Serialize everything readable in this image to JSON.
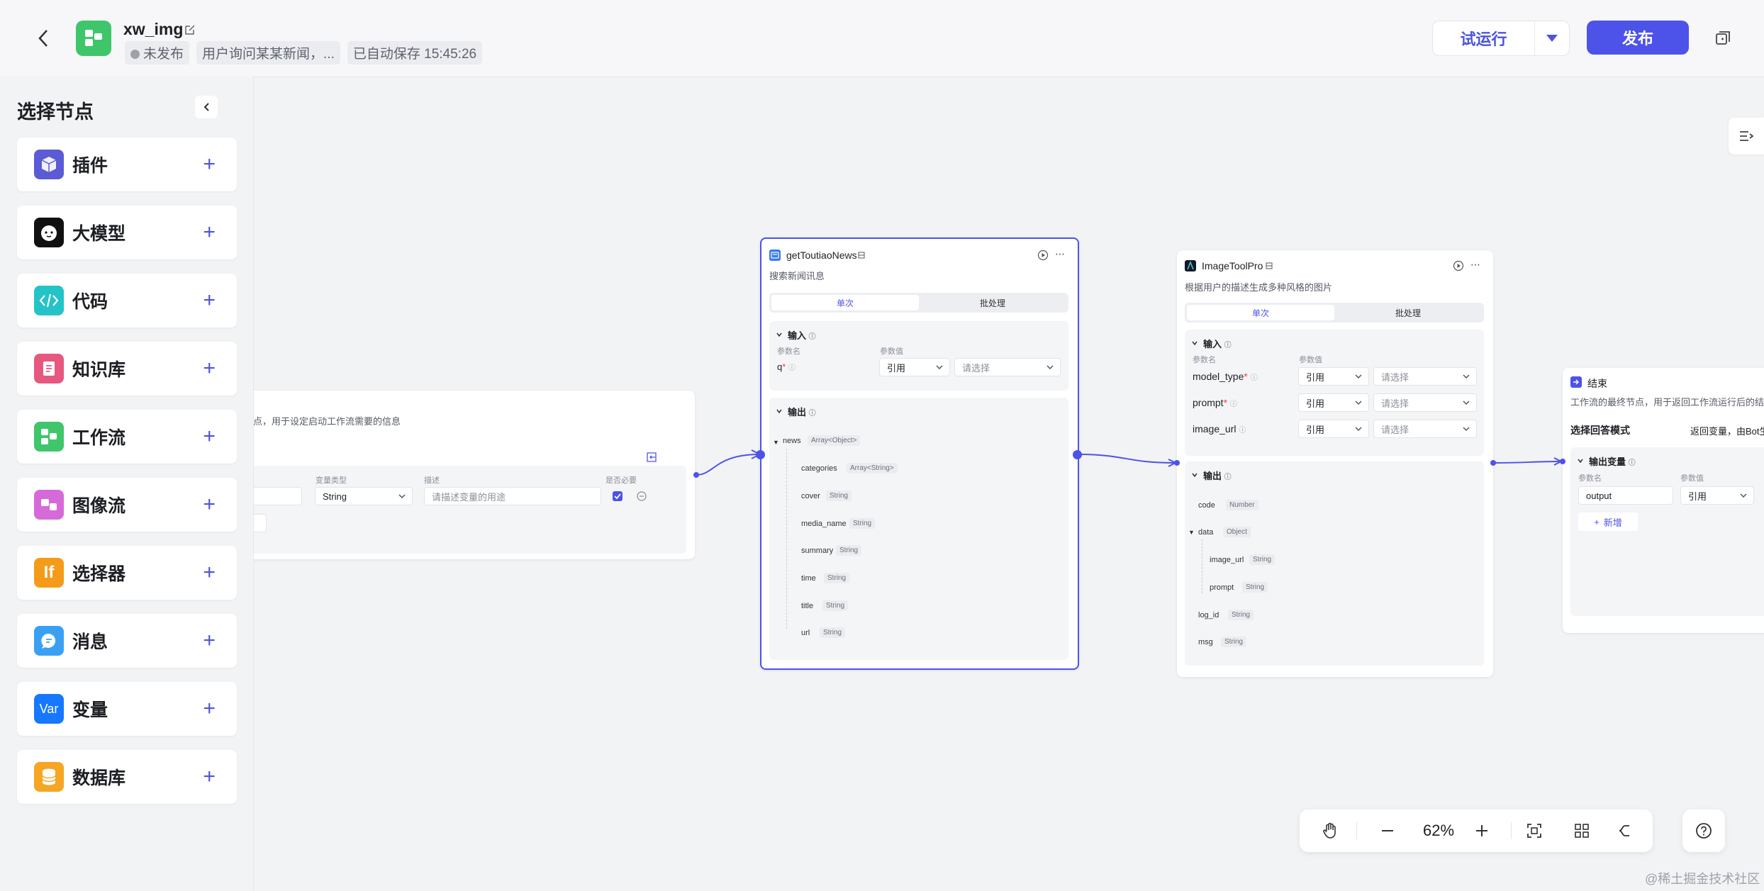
{
  "header": {
    "app_name": "xw_img",
    "status": "未发布",
    "description": "用户询问某某新闻，...",
    "autosave": "已自动保存 15:45:26",
    "trial_run_label": "试运行",
    "publish_label": "发布"
  },
  "sidebar": {
    "title": "选择节点",
    "items": [
      {
        "label": "插件",
        "icon": "cube-icon",
        "color": "#5b5bd6"
      },
      {
        "label": "大模型",
        "icon": "llm-face-icon",
        "color": "#111111"
      },
      {
        "label": "代码",
        "icon": "code-icon",
        "color": "#24c3c8"
      },
      {
        "label": "知识库",
        "icon": "knowledge-icon",
        "color": "#e6587f"
      },
      {
        "label": "工作流",
        "icon": "workflow-icon",
        "color": "#3fc66b"
      },
      {
        "label": "图像流",
        "icon": "imageflow-icon",
        "color": "#d56ad8"
      },
      {
        "label": "选择器",
        "icon": "if-icon",
        "glyph": "If",
        "color": "#f59b1a"
      },
      {
        "label": "消息",
        "icon": "message-icon",
        "color": "#3aa0f3"
      },
      {
        "label": "变量",
        "icon": "var-icon",
        "glyph": "Var",
        "color": "#1677ff"
      },
      {
        "label": "数据库",
        "icon": "database-icon",
        "color": "#f5a623"
      }
    ]
  },
  "start_node": {
    "desc": "节点，用于设定启动工作流需要的信息",
    "col_type": "变量类型",
    "col_desc": "描述",
    "col_required": "是否必要",
    "type_value": "String",
    "desc_placeholder": "请描述变量的用途",
    "name_fragment": "s"
  },
  "news_node": {
    "title": "getToutiaoNews",
    "desc": "搜索新闻讯息",
    "tab_single": "单次",
    "tab_batch": "批处理",
    "input_title": "输入",
    "col_name": "参数名",
    "col_value": "参数值",
    "input_param": "q",
    "ref_label": "引用",
    "select_placeholder": "请选择",
    "output_title": "输出",
    "outputs": [
      {
        "name": "news",
        "type": "Array<Object>"
      },
      {
        "name": "categories",
        "type": "Array<String>"
      },
      {
        "name": "cover",
        "type": "String"
      },
      {
        "name": "media_name",
        "type": "String"
      },
      {
        "name": "summary",
        "type": "String"
      },
      {
        "name": "time",
        "type": "String"
      },
      {
        "name": "title",
        "type": "String"
      },
      {
        "name": "url",
        "type": "String"
      }
    ]
  },
  "image_node": {
    "title": "ImageToolPro",
    "desc": "根据用户的描述生成多种风格的图片",
    "tab_single": "单次",
    "tab_batch": "批处理",
    "input_title": "输入",
    "col_name": "参数名",
    "col_value": "参数值",
    "inputs": [
      {
        "name": "model_type",
        "required": true
      },
      {
        "name": "prompt",
        "required": true
      },
      {
        "name": "image_url",
        "required": false
      }
    ],
    "ref_label": "引用",
    "select_placeholder": "请选择",
    "output_title": "输出",
    "outputs": [
      {
        "name": "code",
        "type": "Number"
      },
      {
        "name": "data",
        "type": "Object"
      },
      {
        "name": "image_url",
        "type": "String"
      },
      {
        "name": "prompt",
        "type": "String"
      },
      {
        "name": "log_id",
        "type": "String"
      },
      {
        "name": "msg",
        "type": "String"
      }
    ]
  },
  "end_node": {
    "title": "结束",
    "desc": "工作流的最终节点，用于返回工作流运行后的结果",
    "mode_label": "选择回答模式",
    "mode_value": "返回变量，由Bot生成",
    "output_var_title": "输出变量",
    "col_name": "参数名",
    "col_value": "参数值",
    "output_name": "output",
    "ref_label": "引用",
    "add_label": "新增"
  },
  "toolbar": {
    "zoom": "62%"
  },
  "watermark": "@稀土掘金技术社区"
}
